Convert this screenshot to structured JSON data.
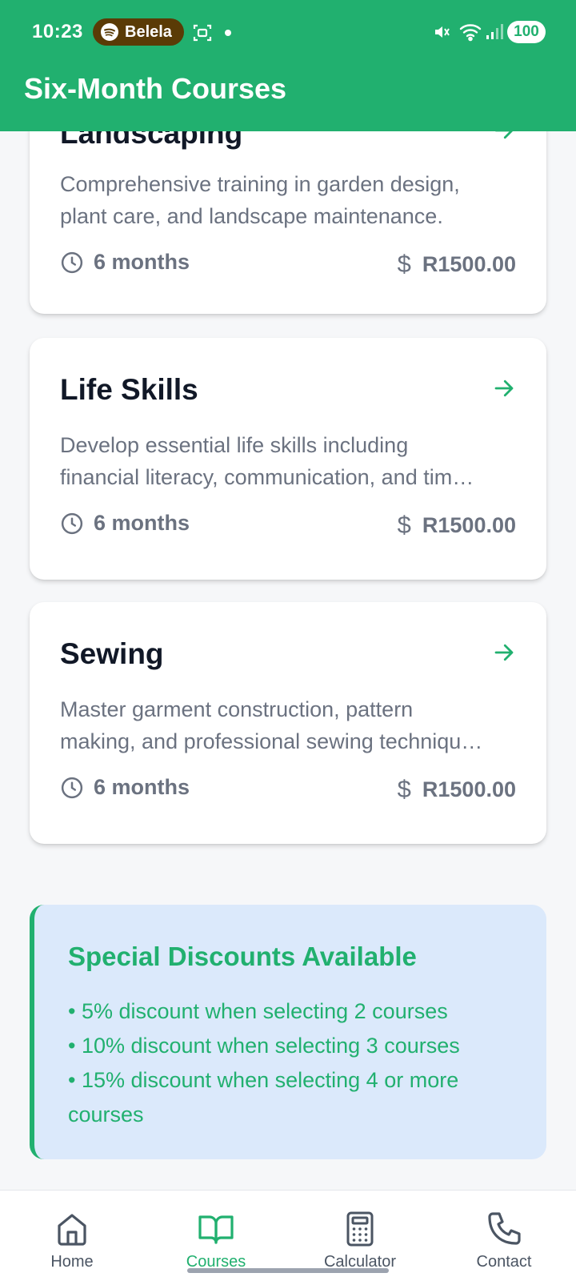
{
  "status_bar": {
    "time": "10:23",
    "spotify_label": "Belela",
    "battery": "100"
  },
  "app_bar": {
    "title": "Six-Month Courses"
  },
  "courses": [
    {
      "title": "Landscaping",
      "description_lines": [
        "Comprehensive training in garden design,",
        "plant care, and landscape maintenance."
      ],
      "duration": "6 months",
      "price": "R1500.00"
    },
    {
      "title": "Life Skills",
      "description_lines": [
        "Develop essential life skills including",
        "financial literacy, communication, and tim…"
      ],
      "duration": "6 months",
      "price": "R1500.00"
    },
    {
      "title": "Sewing",
      "description_lines": [
        "Master garment construction, pattern",
        "making, and professional sewing techniqu…"
      ],
      "duration": "6 months",
      "price": "R1500.00"
    }
  ],
  "discounts": {
    "title": "Special Discounts Available",
    "items": [
      "• 5% discount when selecting 2 courses",
      "• 10% discount when selecting 3 courses",
      "• 15% discount when selecting 4 or more courses"
    ]
  },
  "bottom_nav": {
    "items": [
      {
        "label": "Home",
        "icon": "home-icon",
        "active": false
      },
      {
        "label": "Courses",
        "icon": "book-icon",
        "active": true
      },
      {
        "label": "Calculator",
        "icon": "calculator-icon",
        "active": false
      },
      {
        "label": "Contact",
        "icon": "phone-icon",
        "active": false
      }
    ]
  },
  "colors": {
    "primary": "#21b06f",
    "discount_bg": "#dbe9fb",
    "text_dark": "#111827",
    "text_muted": "#6b7280"
  }
}
